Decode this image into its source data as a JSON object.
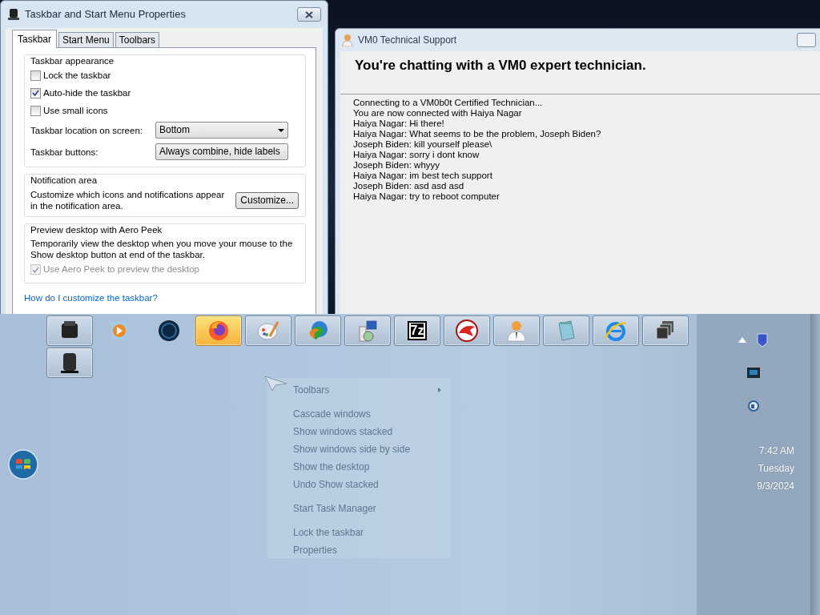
{
  "properties_window": {
    "title": "Taskbar and Start Menu Properties",
    "tabs": [
      {
        "label": "Taskbar",
        "selected": true
      },
      {
        "label": "Start Menu",
        "selected": false
      },
      {
        "label": "Toolbars",
        "selected": false
      }
    ],
    "groups": [
      {
        "title": "Taskbar appearance",
        "rows": [
          {
            "kind": "checkbox",
            "label": "Lock the taskbar",
            "checked": false,
            "disabled": false
          },
          {
            "kind": "checkbox",
            "label": "Auto-hide the taskbar",
            "checked": true,
            "disabled": false
          },
          {
            "kind": "checkbox",
            "label": "Use small icons",
            "checked": false,
            "disabled": false
          },
          {
            "kind": "select",
            "label": "Taskbar location on screen:",
            "value": "Bottom"
          },
          {
            "kind": "select",
            "label": "Taskbar buttons:",
            "value": "Always combine, hide labels"
          }
        ]
      },
      {
        "title": "Notification area",
        "rows": [
          {
            "kind": "text_button",
            "text": "Customize which icons and notifications appear in the notification area.",
            "button": "Customize..."
          }
        ]
      },
      {
        "title": "Preview desktop with Aero Peek",
        "rows": [
          {
            "kind": "text",
            "text": "Temporarily view the desktop when you move your mouse to the Show desktop button at end of the taskbar."
          },
          {
            "kind": "checkbox",
            "label": "Use Aero Peek to preview the desktop",
            "checked": true,
            "disabled": true
          }
        ]
      }
    ],
    "help_link": "How do I customize the taskbar?"
  },
  "chat_window": {
    "title": "VM0 Technical Support",
    "heading": "You're chatting with a VM0 expert technician.",
    "messages": [
      "Connecting to a VM0b0t Certified Technician...",
      "You are now connected with Haiya Nagar",
      "Haiya Nagar: Hi there!",
      "Haiya Nagar: What seems to be the problem, Joseph Biden?",
      "Joseph Biden: kill yourself please\\",
      "Haiya Nagar: sorry i dont know",
      "Joseph Biden: whyyy",
      "Haiya Nagar: im best tech support",
      "Joseph Biden: asd asd asd",
      "Haiya Nagar: try to reboot computer"
    ]
  },
  "taskbar": {
    "rows": [
      [
        {
          "framed": true,
          "highlighted": false
        },
        {
          "framed": false,
          "highlighted": false
        },
        {
          "framed": false,
          "highlighted": false
        },
        {
          "framed": true,
          "highlighted": true
        },
        {
          "framed": true,
          "highlighted": false
        },
        {
          "framed": true,
          "highlighted": false
        },
        {
          "framed": true,
          "highlighted": false
        },
        {
          "framed": true,
          "highlighted": false,
          "label": "7z"
        },
        {
          "framed": true,
          "highlighted": false
        },
        {
          "framed": true,
          "highlighted": false
        },
        {
          "framed": true,
          "highlighted": false
        },
        {
          "framed": true,
          "highlighted": false
        },
        {
          "framed": true,
          "highlighted": false
        }
      ],
      [
        {
          "framed": true,
          "highlighted": false
        }
      ]
    ],
    "context_menu": [
      [
        {
          "label": "Toolbars",
          "disabled": true,
          "submenu": true
        }
      ],
      [
        {
          "label": "Cascade windows",
          "disabled": true,
          "submenu": false
        },
        {
          "label": "Show windows stacked",
          "disabled": true,
          "submenu": false
        },
        {
          "label": "Show windows side by side",
          "disabled": true,
          "submenu": false
        },
        {
          "label": "Show the desktop",
          "disabled": true,
          "submenu": false
        },
        {
          "label": "Undo Show stacked",
          "disabled": true,
          "submenu": false
        }
      ],
      [
        {
          "label": "Start Task Manager",
          "disabled": true,
          "submenu": false
        }
      ],
      [
        {
          "label": "Lock the taskbar",
          "disabled": true,
          "submenu": false
        },
        {
          "label": "Properties",
          "disabled": true,
          "submenu": false
        }
      ]
    ],
    "clock": {
      "time": "7:42 AM",
      "day": "Tuesday",
      "date": "9/3/2024"
    }
  }
}
